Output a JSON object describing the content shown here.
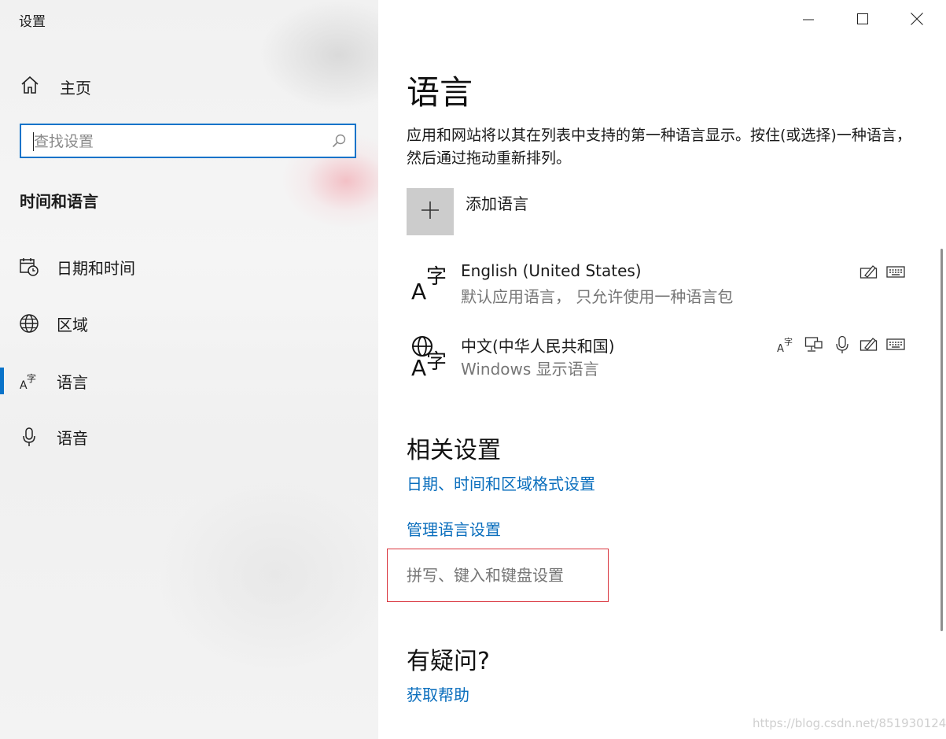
{
  "window": {
    "title": "设置",
    "controls": [
      "minimize",
      "maximize",
      "close"
    ]
  },
  "sidebar": {
    "home_label": "主页",
    "search_placeholder": "查找设置",
    "section_title": "时间和语言",
    "items": [
      {
        "label": "日期和时间",
        "icon": "calendar-clock-icon",
        "active": false
      },
      {
        "label": "区域",
        "icon": "globe-icon",
        "active": false
      },
      {
        "label": "语言",
        "icon": "language-icon",
        "active": true
      },
      {
        "label": "语音",
        "icon": "microphone-icon",
        "active": false
      }
    ]
  },
  "main": {
    "title": "语言",
    "description": "应用和网站将以其在列表中支持的第一种语言显示。按住(或选择)一种语言，然后通过拖动重新排列。",
    "add_language_label": "添加语言",
    "languages": [
      {
        "name": "English (United States)",
        "subtitle": "默认应用语言， 只允许使用一种语言包",
        "features": [
          "handwriting-icon",
          "keyboard-icon"
        ]
      },
      {
        "name": "中文(中华人民共和国)",
        "subtitle": "Windows 显示语言",
        "features": [
          "display-language-icon",
          "text-to-speech-icon",
          "speech-icon",
          "handwriting-icon",
          "keyboard-icon"
        ]
      }
    ],
    "related_title": "相关设置",
    "related_links": [
      "日期、时间和区域格式设置",
      "管理语言设置",
      "拼写、键入和键盘设置"
    ],
    "help_title": "有疑问?",
    "help_link": "获取帮助"
  },
  "watermark": "https://blog.csdn.net/851930124",
  "colors": {
    "accent": "#0a73c9",
    "link": "#0a6ebd",
    "highlight_border": "#d9343d",
    "add_tile": "#cccccc"
  }
}
